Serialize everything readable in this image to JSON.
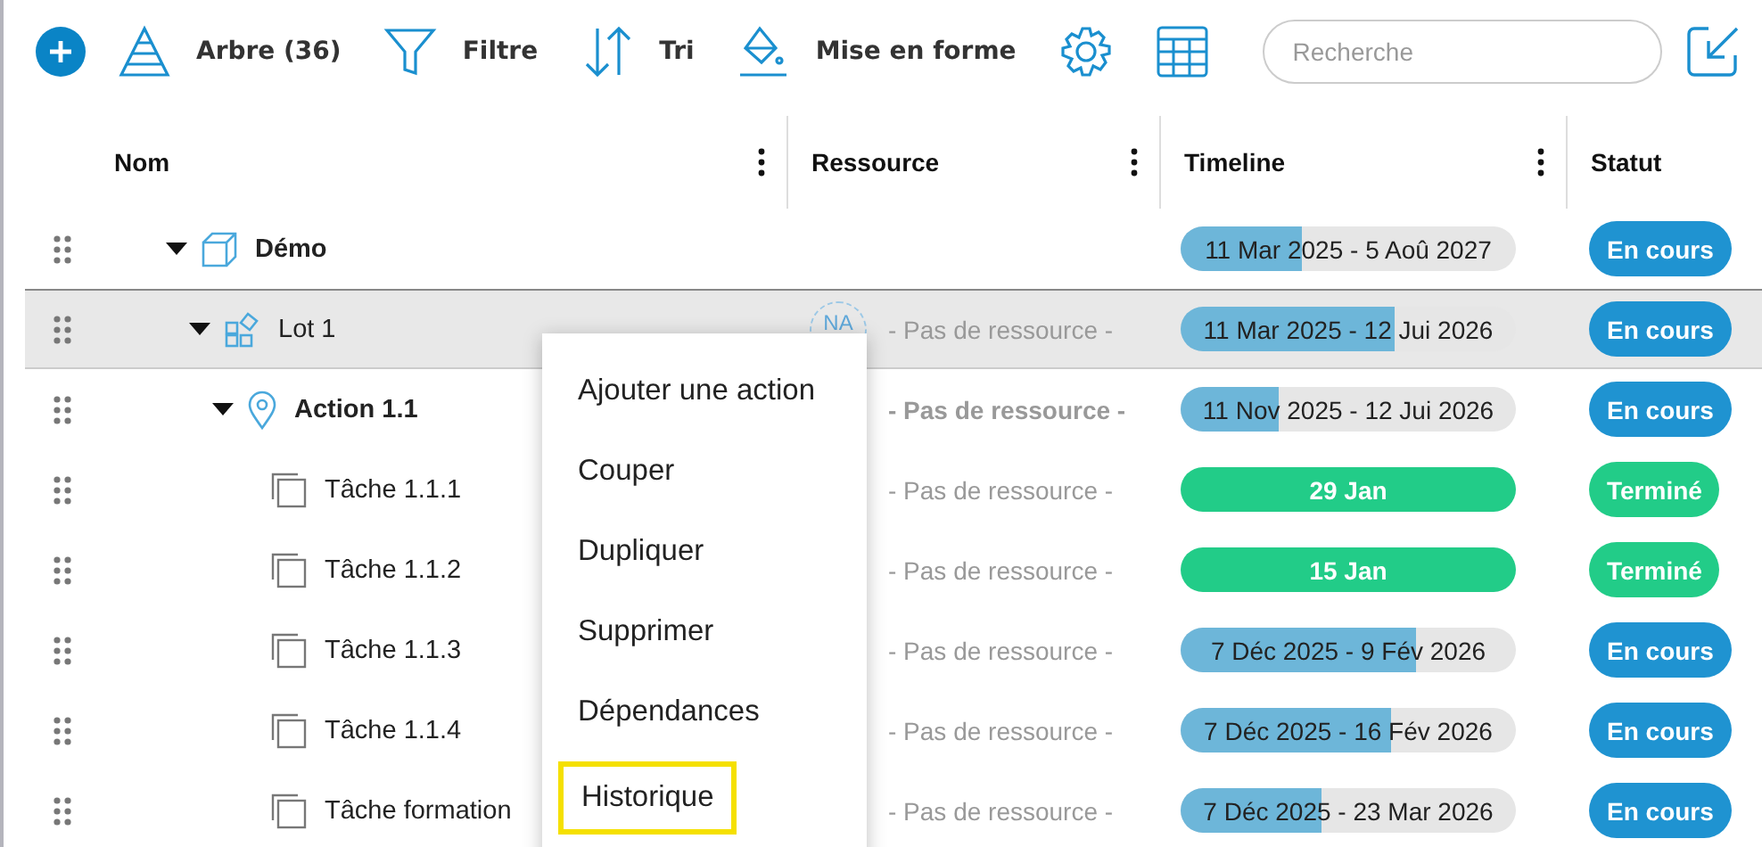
{
  "toolbar": {
    "items": [
      {
        "kind": "tree",
        "label": "Arbre (36)"
      },
      {
        "kind": "filter",
        "label": "Filtre"
      },
      {
        "kind": "sort",
        "label": "Tri"
      },
      {
        "kind": "format",
        "label": "Mise en forme"
      }
    ],
    "search": {
      "placeholder": "Recherche"
    }
  },
  "table": {
    "columns": [
      "Nom",
      "Ressource",
      "Timeline",
      "Statut"
    ],
    "rows": [
      {
        "kind": "project",
        "name": "Démo",
        "bold": true,
        "expanded": true,
        "selected": false,
        "timeline": {
          "kind": "progress",
          "label": "11 Mar 2025 - 5 Aoû 2027",
          "level": 0.36
        },
        "status": {
          "label": "En cours",
          "color": "#1f93d1"
        },
        "children": [
          {
            "kind": "lot",
            "name": "Lot 1",
            "bold": false,
            "expanded": true,
            "selected": true,
            "resource": {
              "avatar": "NA",
              "text": "- Pas de ressource -"
            },
            "timeline": {
              "kind": "progress",
              "label": "11 Mar 2025 - 12 Jui 2026",
              "level": 0.64
            },
            "status": {
              "label": "En cours",
              "color": "#1f93d1"
            },
            "children": [
              {
                "kind": "action",
                "name": "Action 1.1",
                "bold": true,
                "expanded": true,
                "selected": false,
                "resource": {
                  "text": "- Pas de ressource -"
                },
                "timeline": {
                  "kind": "progress",
                  "label": "11 Nov 2025 - 12 Jui 2026",
                  "level": 0.29
                },
                "status": {
                  "label": "En cours",
                  "color": "#1f93d1"
                },
                "children": [
                  {
                    "kind": "task",
                    "name": "Tâche 1.1.1",
                    "bold": false,
                    "selected": false,
                    "resource": {
                      "text": "- Pas de ressource -"
                    },
                    "timeline": {
                      "kind": "done",
                      "label": "29 Jan"
                    },
                    "status": {
                      "label": "Terminé",
                      "color": "#22cc88"
                    }
                  },
                  {
                    "kind": "task",
                    "name": "Tâche 1.1.2",
                    "bold": false,
                    "selected": false,
                    "resource": {
                      "text": "- Pas de ressource -"
                    },
                    "timeline": {
                      "kind": "done",
                      "label": "15 Jan"
                    },
                    "status": {
                      "label": "Terminé",
                      "color": "#22cc88"
                    }
                  },
                  {
                    "kind": "task",
                    "name": "Tâche 1.1.3",
                    "bold": false,
                    "selected": false,
                    "resource": {
                      "text": "- Pas de ressource -"
                    },
                    "timeline": {
                      "kind": "progress",
                      "label": "7 Déc 2025 - 9 Fév 2026",
                      "level": 0.7
                    },
                    "status": {
                      "label": "En cours",
                      "color": "#1f93d1"
                    }
                  },
                  {
                    "kind": "task",
                    "name": "Tâche 1.1.4",
                    "bold": false,
                    "selected": false,
                    "resource": {
                      "text": "- Pas de ressource -"
                    },
                    "timeline": {
                      "kind": "progress",
                      "label": "7 Déc 2025 - 16 Fév 2026",
                      "level": 0.63
                    },
                    "status": {
                      "label": "En cours",
                      "color": "#1f93d1"
                    }
                  },
                  {
                    "kind": "task",
                    "name": "Tâche formation",
                    "bold": false,
                    "selected": false,
                    "resource": {
                      "text": "- Pas de ressource -"
                    },
                    "timeline": {
                      "kind": "progress",
                      "label": "7 Déc 2025 - 23 Mar 2026",
                      "level": 0.42
                    },
                    "status": {
                      "label": "En cours",
                      "color": "#1f93d1"
                    }
                  }
                ]
              }
            ]
          }
        ]
      }
    ]
  },
  "context_menu": {
    "items": [
      {
        "label": "Ajouter une action",
        "selected": false
      },
      {
        "label": "Couper",
        "selected": false
      },
      {
        "label": "Dupliquer",
        "selected": false
      },
      {
        "label": "Supprimer",
        "selected": false
      },
      {
        "label": "Dépendances",
        "selected": false
      },
      {
        "label": "Historique",
        "selected": true
      }
    ]
  }
}
